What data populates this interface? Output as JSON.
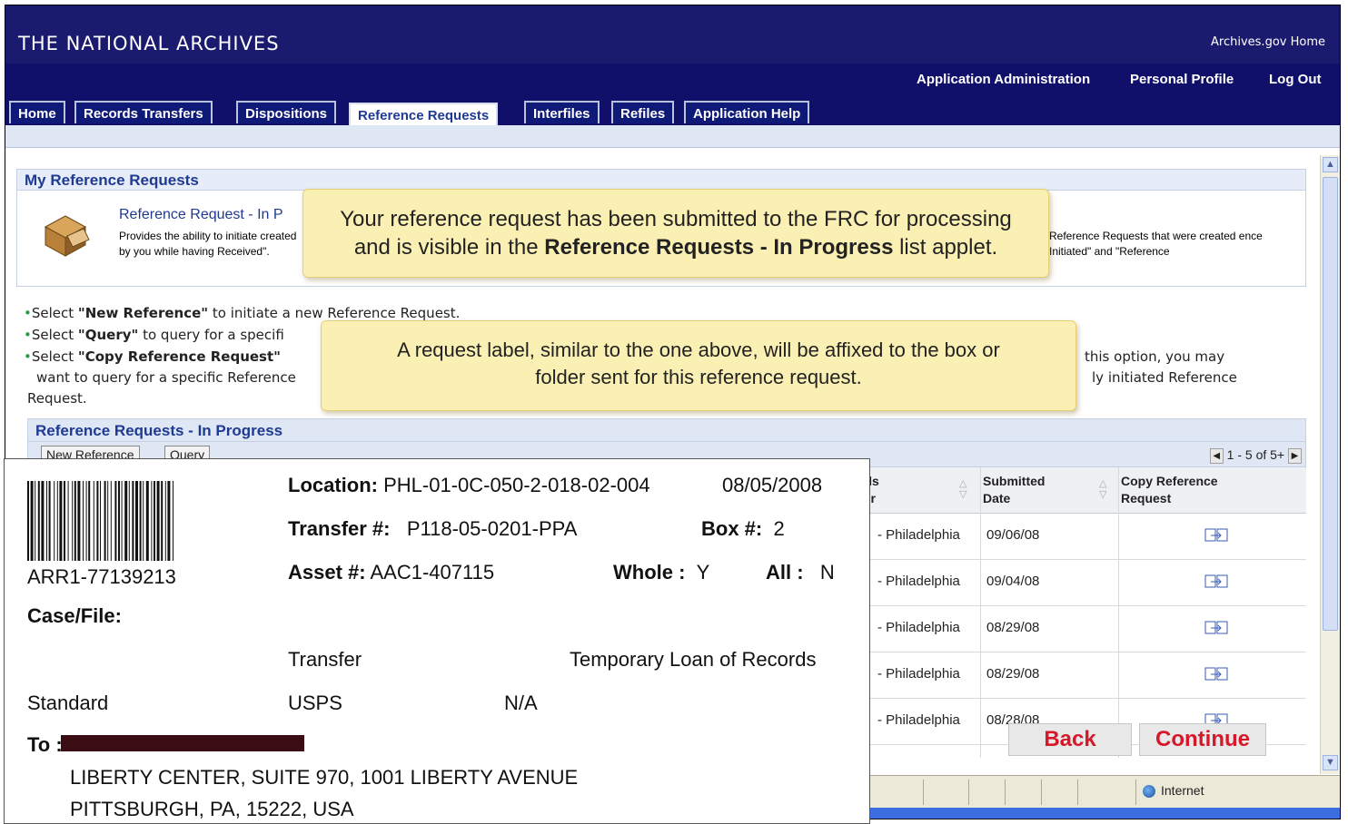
{
  "header": {
    "site_title": "THE NATIONAL ARCHIVES",
    "home_link": "Archives.gov Home",
    "user_links": [
      "Application Administration",
      "Personal Profile",
      "Log Out"
    ]
  },
  "tabs": [
    {
      "label": "Home",
      "active": false
    },
    {
      "label": "Records Transfers",
      "active": false
    },
    {
      "label": "Dispositions",
      "active": false
    },
    {
      "label": "Reference Requests",
      "active": true
    },
    {
      "label": "Interfiles",
      "active": false
    },
    {
      "label": "Refiles",
      "active": false
    },
    {
      "label": "Application Help",
      "active": false
    }
  ],
  "section": {
    "title": "My Reference Requests",
    "intro_title": "Reference Request - In P",
    "intro_desc_left": "Provides the ability to initiate created by you while having Received\".",
    "intro_desc_right": "Reference Requests that were created ence Initiated\" and \"Reference"
  },
  "instructions": {
    "line1_pre": "Select ",
    "line1_bold": "\"New Reference\"",
    "line1_post": " to initiate a new Reference Request.",
    "line2_pre": "Select ",
    "line2_bold": "\"Query\"",
    "line2_post": " to query for a specifi",
    "line3_pre": "Select ",
    "line3_bold": "\"Copy Reference Request\"",
    "line3_right": "this option, you may",
    "line4_left": "want to query for a specific Reference",
    "line4_right": "ly initiated Reference",
    "line5": "Request."
  },
  "list": {
    "title": "Reference Requests - In Progress",
    "new_button": "New Reference",
    "query_button": "Query",
    "pager_text": "1 - 5 of 5+",
    "col_records_center_1": "rds",
    "col_records_center_2": "ter",
    "col_submitted_1": "Submitted",
    "col_submitted_2": "Date",
    "col_copy_1": "Copy Reference",
    "col_copy_2": "Request",
    "rows": [
      {
        "center": "- Philadelphia",
        "date": "09/06/08"
      },
      {
        "center": "- Philadelphia",
        "date": "09/04/08"
      },
      {
        "center": "- Philadelphia",
        "date": "08/29/08"
      },
      {
        "center": "- Philadelphia",
        "date": "08/29/08"
      },
      {
        "center": "- Philadelphia",
        "date": "08/28/08"
      }
    ]
  },
  "callouts": {
    "c1_line1": "Your reference request has been submitted to the FRC for processing",
    "c1_line2_pre": "and is visible in the ",
    "c1_line2_bold": "Reference Requests - In Progress",
    "c1_line2_post": " list applet.",
    "c2_line1": "A request label, similar to the one above, will be affixed to the box or",
    "c2_line2": "folder sent for this reference request."
  },
  "label": {
    "barcode_text": "ARR1-77139213",
    "location_label": "Location:",
    "location_value": "PHL-01-0C-050-2-018-02-004",
    "date": "08/05/2008",
    "transfer_label": "Transfer #:",
    "transfer_value": "P118-05-0201-PPA",
    "box_label": "Box #:",
    "box_value": "2",
    "asset_label": "Asset #:",
    "asset_value": "AAC1-407115",
    "whole_label": "Whole :",
    "whole_value": "Y",
    "all_label": "All :",
    "all_value": "N",
    "case_label": "Case/File:",
    "type": "Transfer",
    "purpose": "Temporary Loan of Records",
    "priority": "Standard",
    "carrier": "USPS",
    "na": "N/A",
    "to_label": "To :",
    "address1": "LIBERTY CENTER, SUITE 970, 1001 LIBERTY AVENUE",
    "address2": "PITTSBURGH, PA, 15222, USA"
  },
  "buttons": {
    "back": "Back",
    "continue": "Continue"
  },
  "status": {
    "zone": "Internet"
  },
  "colors": {
    "nav": "#10106a",
    "accent": "#1f3a93",
    "callout": "#fbf0b4",
    "action": "#d7182a"
  }
}
